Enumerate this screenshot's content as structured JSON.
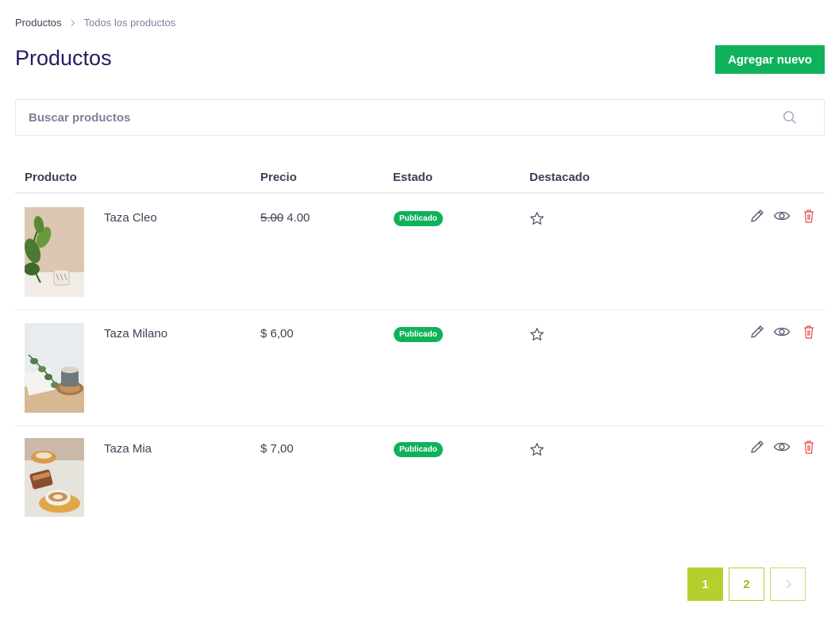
{
  "breadcrumb": {
    "first": "Productos",
    "current": "Todos los productos"
  },
  "header": {
    "title": "Productos",
    "add_button": "Agregar nuevo"
  },
  "search": {
    "placeholder": "Buscar productos",
    "icon": "search-icon"
  },
  "table": {
    "columns": [
      "Producto",
      "Precio",
      "Estado",
      "Destacado"
    ],
    "rows": [
      {
        "name": "Taza Cleo",
        "price_old": "5.00",
        "price": "4.00",
        "status": "Publicado",
        "featured": false
      },
      {
        "name": "Taza Milano",
        "price_old": "",
        "price": "$ 6,00",
        "status": "Publicado",
        "featured": false
      },
      {
        "name": "Taza Mia",
        "price_old": "",
        "price": "$ 7,00",
        "status": "Publicado",
        "featured": false
      }
    ]
  },
  "pagination": {
    "pages": [
      "1",
      "2"
    ],
    "current": "1",
    "next_icon": "chevron-right-icon"
  },
  "colors": {
    "primary_green": "#0fb25a",
    "pagination_lime": "#b5cf2e",
    "title_purple": "#2a1a5e",
    "delete_red": "#e24c4c"
  }
}
